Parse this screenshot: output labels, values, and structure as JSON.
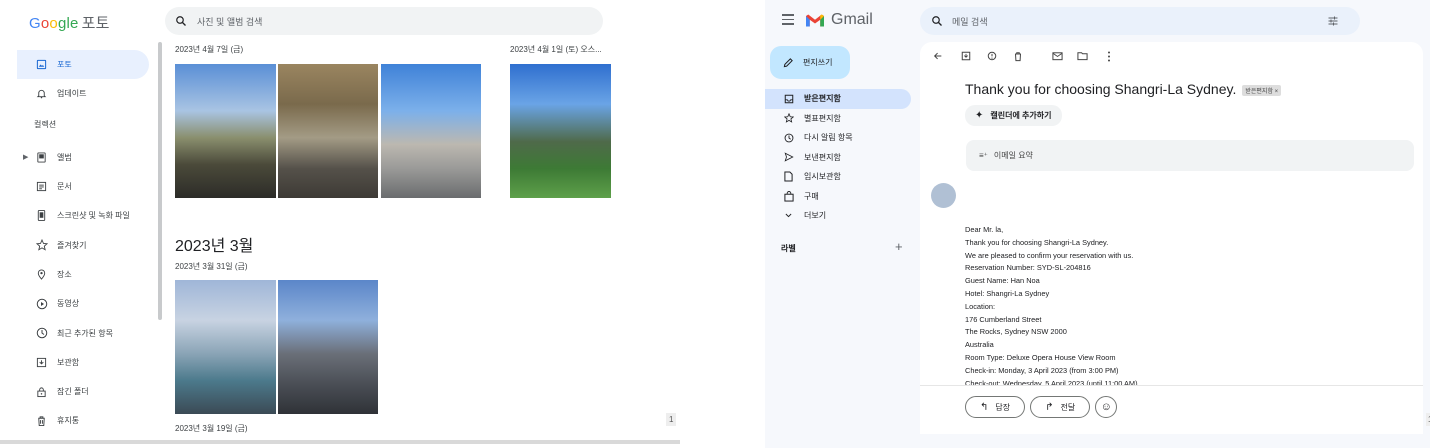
{
  "photos": {
    "logo": {
      "g1": "G",
      "g2": "o",
      "g3": "o",
      "g4": "gle",
      "product": "포토"
    },
    "search_placeholder": "사진 및 앨범 검색",
    "nav_top": [
      {
        "label": "포토",
        "icon": "photo-icon",
        "active": true
      },
      {
        "label": "업데이트",
        "icon": "bell-icon",
        "active": false
      }
    ],
    "section_label": "컬렉션",
    "nav_collections": [
      {
        "label": "앨범",
        "icon": "album-icon"
      },
      {
        "label": "문서",
        "icon": "document-icon"
      },
      {
        "label": "스크린샷 및 녹화 파일",
        "icon": "screenshot-icon"
      },
      {
        "label": "즐겨찾기",
        "icon": "star-icon"
      },
      {
        "label": "장소",
        "icon": "location-icon"
      },
      {
        "label": "동영상",
        "icon": "video-icon"
      },
      {
        "label": "최근 추가된 항목",
        "icon": "clock-icon"
      },
      {
        "label": "보관함",
        "icon": "archive-icon"
      },
      {
        "label": "잠긴 폴더",
        "icon": "lock-icon"
      },
      {
        "label": "휴지통",
        "icon": "trash-icon"
      }
    ],
    "dates": {
      "d1": "2023년 4월 7일 (금)",
      "d2": "2023년 4월 1일 (토)  오스...",
      "month": "2023년 3월",
      "d3": "2023년 3월 31일 (금)",
      "d4": "2023년 3월 19일 (금)"
    },
    "zoom": "1"
  },
  "gmail": {
    "logo_text": "Gmail",
    "search_placeholder": "메일 검색",
    "compose_label": "편지쓰기",
    "nav": [
      {
        "label": "받은편지함",
        "icon": "inbox-icon",
        "active": true
      },
      {
        "label": "별표편지함",
        "icon": "star-icon",
        "active": false
      },
      {
        "label": "다시 알림 항목",
        "icon": "clock-icon",
        "active": false
      },
      {
        "label": "보낸편지함",
        "icon": "send-icon",
        "active": false
      },
      {
        "label": "임시보관함",
        "icon": "draft-icon",
        "active": false
      },
      {
        "label": "구매",
        "icon": "purchase-icon",
        "active": false
      },
      {
        "label": "더보기",
        "icon": "chevron-down-icon",
        "active": false
      }
    ],
    "labels_heading": "라벨",
    "subject": "Thank you for choosing Shangri-La Sydney.",
    "subject_chip": "받은편지함 ×",
    "calendar_button": "캘린더에 추가하기",
    "summary_button": "이메일 요약",
    "body_lines": [
      "Dear Mr. la,",
      "Thank you for choosing Shangri-La Sydney.",
      "We are pleased to confirm your reservation with us.",
      "Reservation Number: SYD-SL-204816",
      "Guest Name: Han Noa",
      "Hotel: Shangri-La Sydney",
      "Location:",
      "176 Cumberland Street",
      "The Rocks, Sydney NSW 2000",
      "Australia",
      "Room Type: Deluxe Opera House View Room",
      "Check-in: Monday, 3 April 2023 (from 3:00 PM)",
      "Check-out: Wednesday, 5 April 2023 (until 11:00 AM)"
    ],
    "reply_label": "답장",
    "forward_label": "전달",
    "zoom": "1"
  },
  "colors": {
    "accent": "#1967d2",
    "compose": "#c2e7ff",
    "active_nav": "#d3e3fd",
    "gmail_bg": "#f6f8fc"
  }
}
